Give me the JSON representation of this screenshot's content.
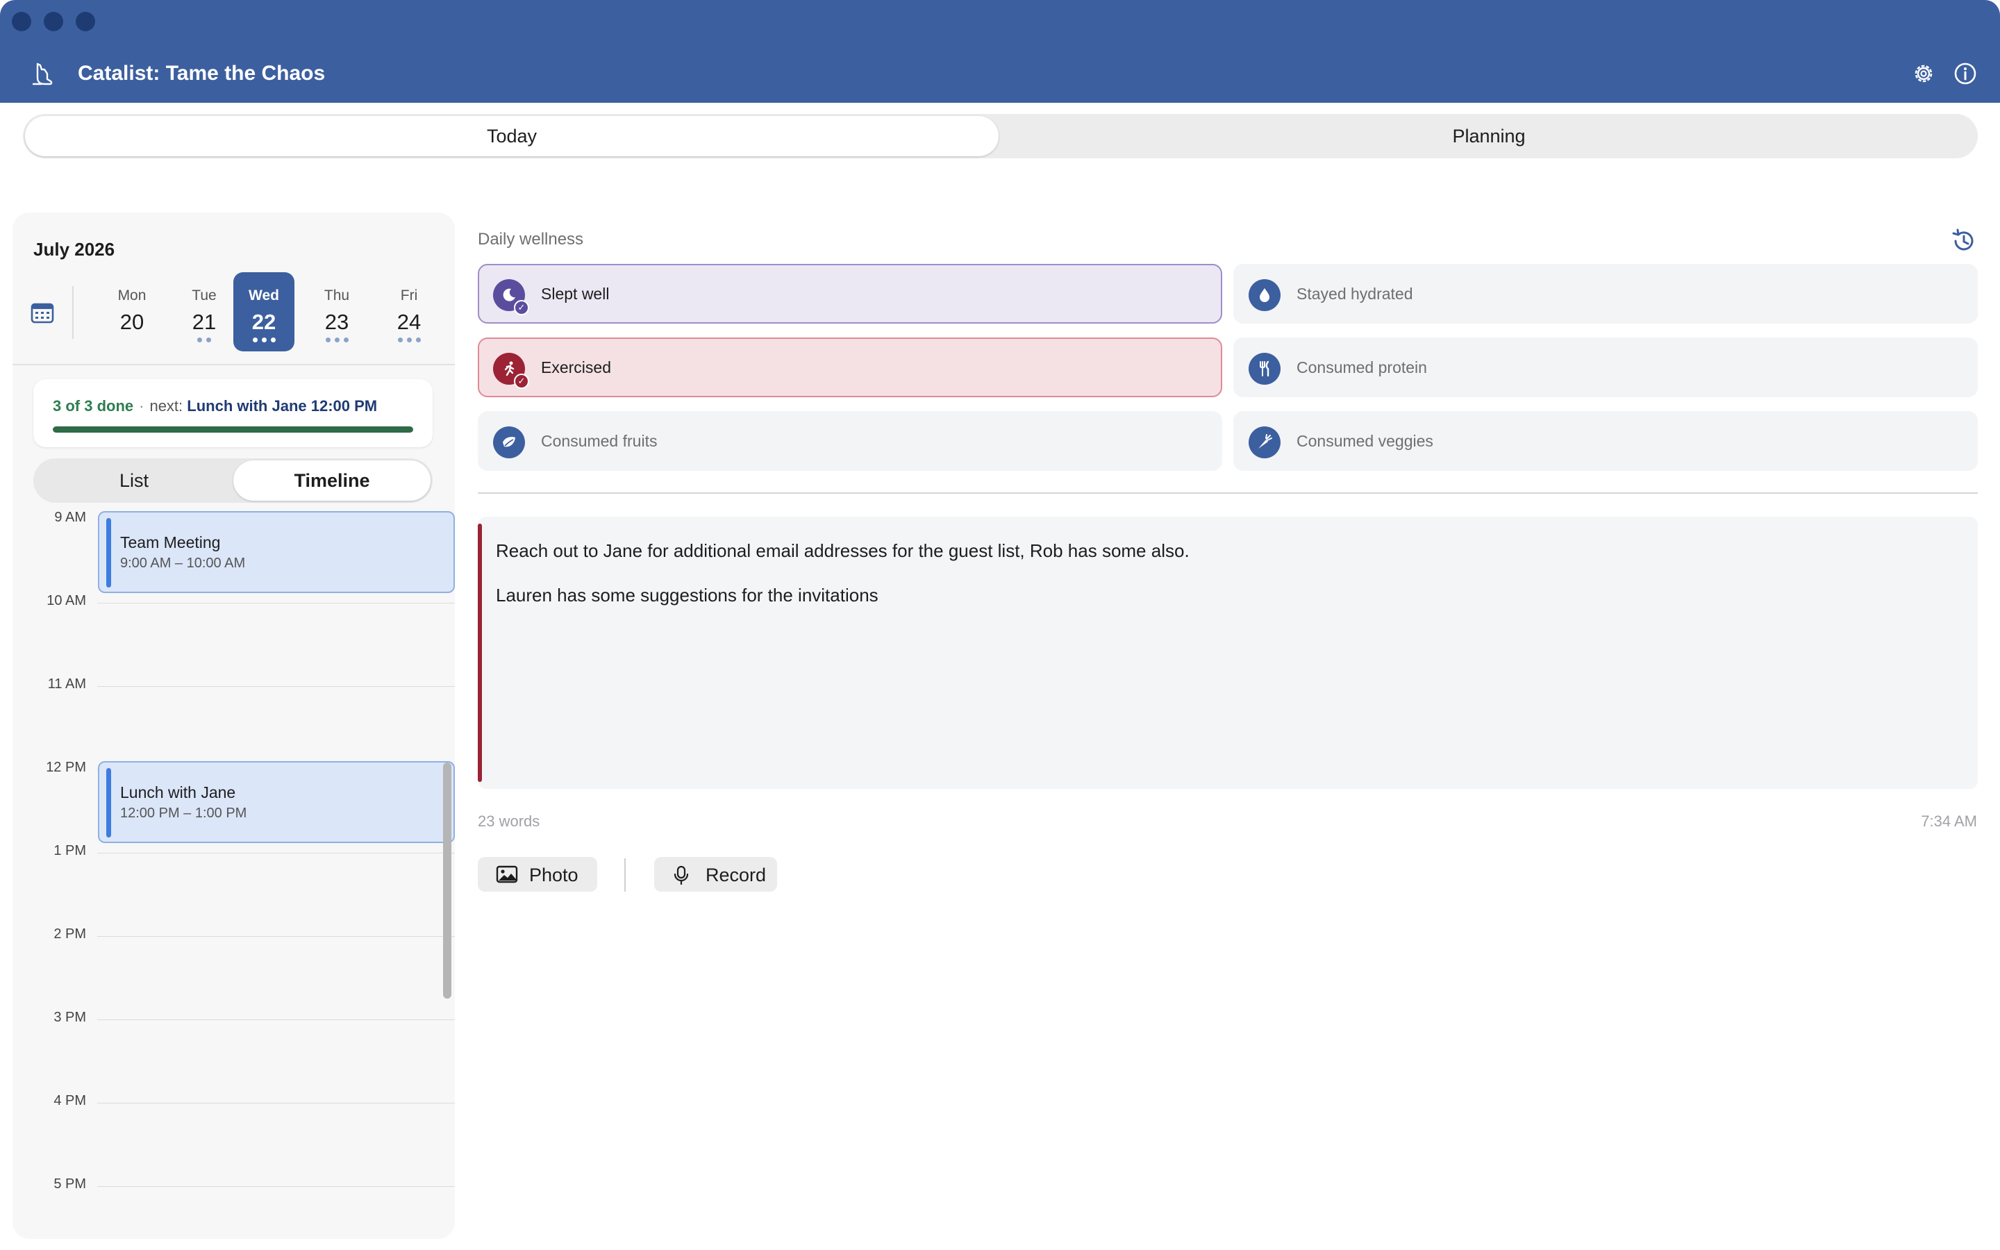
{
  "window": {
    "title": "Catalist: Tame the Chaos"
  },
  "main_tabs": [
    {
      "label": "Today",
      "active": true
    },
    {
      "label": "Planning",
      "active": false
    }
  ],
  "calendar": {
    "month_label": "July 2026",
    "days": [
      {
        "name": "Mon",
        "num": "20",
        "dots": 0,
        "active": false
      },
      {
        "name": "Tue",
        "num": "21",
        "dots": 2,
        "active": false
      },
      {
        "name": "Wed",
        "num": "22",
        "dots": 3,
        "active": true
      },
      {
        "name": "Thu",
        "num": "23",
        "dots": 3,
        "active": false
      },
      {
        "name": "Fri",
        "num": "24",
        "dots": 3,
        "active": false
      }
    ]
  },
  "status": {
    "done_text": "3 of 3 done",
    "separator": "·",
    "next_prefix": "next:",
    "next_event": "Lunch with Jane 12:00 PM",
    "progress_fraction": 1.0
  },
  "view_toggle": {
    "list_label": "List",
    "timeline_label": "Timeline",
    "active": "Timeline"
  },
  "timeline": {
    "hours": [
      "9 AM",
      "10 AM",
      "11 AM",
      "12 PM",
      "1 PM",
      "2 PM",
      "3 PM",
      "4 PM",
      "5 PM"
    ],
    "events": [
      {
        "title": "Team Meeting",
        "time": "9:00 AM – 10:00 AM"
      },
      {
        "title": "Lunch with Jane",
        "time": "12:00 PM – 1:00 PM"
      }
    ]
  },
  "wellness": {
    "label": "Daily wellness",
    "items": [
      {
        "label": "Slept well",
        "icon": "moon-icon",
        "checked": true,
        "color": "#5b4d9e"
      },
      {
        "label": "Stayed hydrated",
        "icon": "water-drop-icon",
        "checked": false
      },
      {
        "label": "Exercised",
        "icon": "running-icon",
        "checked": true,
        "color": "#9b2335"
      },
      {
        "label": "Consumed protein",
        "icon": "fork-knife-icon",
        "checked": false
      },
      {
        "label": "Consumed fruits",
        "icon": "leaf-icon",
        "checked": false
      },
      {
        "label": "Consumed veggies",
        "icon": "carrot-icon",
        "checked": false
      }
    ]
  },
  "note": {
    "lines": [
      "Reach out to Jane for additional email addresses for the guest list, Rob has some also.",
      "Lauren has some suggestions for the invitations"
    ],
    "word_count": "23 words",
    "timestamp": "7:34 AM"
  },
  "actions": {
    "photo_label": "Photo",
    "record_label": "Record"
  },
  "colors": {
    "accent": "#3c5f9f",
    "progress": "#2e6b46",
    "note_bar": "#9b2335",
    "event": "#3d7ce0"
  }
}
